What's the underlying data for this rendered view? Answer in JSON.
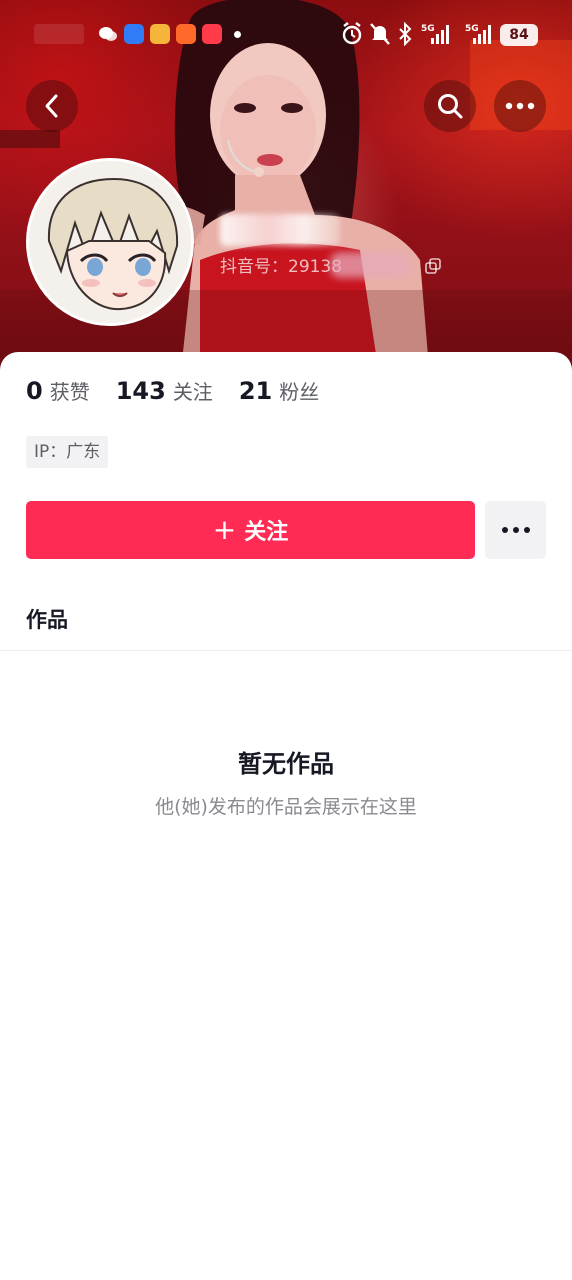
{
  "status_bar": {
    "battery": "84",
    "network_1": "5G",
    "network_2": "5G"
  },
  "header": {
    "back_icon": "chevron-left-icon",
    "search_icon": "search-icon",
    "more_icon": "more-horizontal-icon"
  },
  "profile": {
    "name": "",
    "douyin_id": "抖音号：29138",
    "copy_icon": "copy-icon"
  },
  "stats": [
    {
      "value": "0",
      "label": "获赞"
    },
    {
      "value": "143",
      "label": "关注"
    },
    {
      "value": "21",
      "label": "粉丝"
    }
  ],
  "ip_tag": "IP：广东",
  "actions": {
    "follow_plus": "+",
    "follow_label": "关注",
    "more_icon": "more-horizontal-icon"
  },
  "tabs": {
    "works": "作品"
  },
  "empty_state": {
    "title": "暂无作品",
    "subtitle": "他(她)发布的作品会展示在这里"
  },
  "colors": {
    "accent": "#fe2c55",
    "banner": "#a3121a",
    "text_primary": "#161823",
    "text_secondary": "#5d5f67",
    "text_muted": "#8a8b91",
    "chip_bg": "#f2f2f4"
  }
}
